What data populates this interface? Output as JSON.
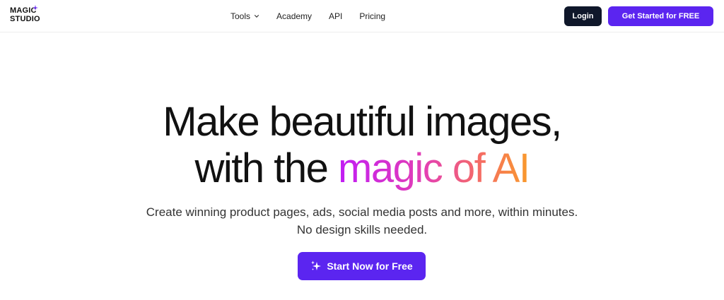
{
  "brand": {
    "logo_line1": "MAGIC",
    "logo_line2": "STUDIO",
    "accent_color": "#5b25f0"
  },
  "nav": {
    "items": [
      {
        "label": "Tools",
        "has_dropdown": true
      },
      {
        "label": "Academy"
      },
      {
        "label": "API"
      },
      {
        "label": "Pricing"
      }
    ],
    "login_label": "Login",
    "get_started_label": "Get Started for FREE"
  },
  "hero": {
    "headline_line1": "Make beautiful images,",
    "headline_line2_plain": "with the ",
    "headline_line2_gradient": "magic of AI",
    "subtitle_line1": "Create winning product pages, ads, social media posts and more, within minutes.",
    "subtitle_line2": "No design skills needed.",
    "cta_label": "Start Now for Free",
    "cta_icon": "sparkles-icon"
  }
}
